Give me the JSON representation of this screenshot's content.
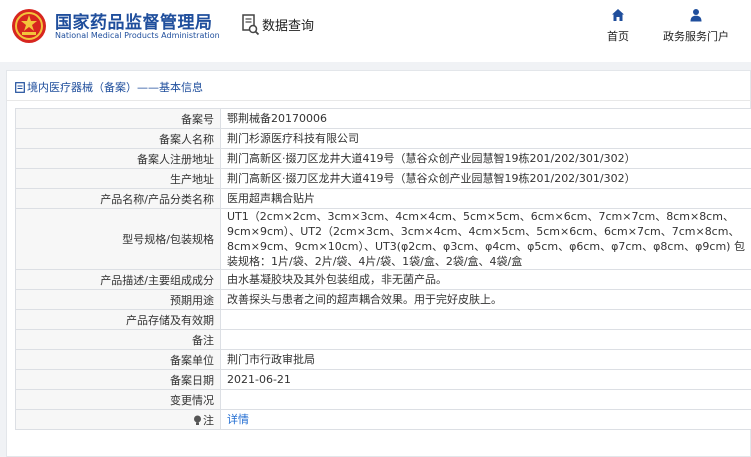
{
  "header": {
    "org_name_cn": "国家药品监督管理局",
    "org_name_en": "National Medical Products Administration",
    "data_query_label": "数据查询",
    "nav": {
      "home_label": "首页",
      "portal_label": "政务服务门户"
    }
  },
  "breadcrumb": {
    "text": "境内医疗器械（备案）——基本信息"
  },
  "colors": {
    "brand_blue": "#1f4e9c",
    "link_blue": "#1f6bd1",
    "label_bg": "#f7f7f7",
    "emblem_red": "#d7261f",
    "emblem_gold": "#f3c33b"
  },
  "record": {
    "rows": [
      {
        "label": "备案号",
        "value": "鄂荆械备20170006"
      },
      {
        "label": "备案人名称",
        "value": "荆门杉源医疗科技有限公司"
      },
      {
        "label": "备案人注册地址",
        "value": "荆门高新区·掇刀区龙井大道419号（慧谷众创产业园慧智19栋201/202/301/302）"
      },
      {
        "label": "生产地址",
        "value": "荆门高新区·掇刀区龙井大道419号（慧谷众创产业园慧智19栋201/202/301/302）"
      },
      {
        "label": "产品名称/产品分类名称",
        "value": "医用超声耦合贴片"
      },
      {
        "label": "型号规格/包装规格",
        "value": "UT1（2cm×2cm、3cm×3cm、4cm×4cm、5cm×5cm、6cm×6cm、7cm×7cm、8cm×8cm、9cm×9cm）、UT2（2cm×3cm、3cm×4cm、4cm×5cm、5cm×6cm、6cm×7cm、7cm×8cm、8cm×9cm、9cm×10cm）、UT3(φ2cm、φ3cm、φ4cm、φ5cm、φ6cm、φ7cm、φ8cm、φ9cm) 包装规格：1片/袋、2片/袋、4片/袋、1袋/盒、2袋/盒、4袋/盒"
      },
      {
        "label": "产品描述/主要组成成分",
        "value": "由水基凝胶块及其外包装组成，非无菌产品。"
      },
      {
        "label": "预期用途",
        "value": "改善探头与患者之间的超声耦合效果。用于完好皮肤上。"
      },
      {
        "label": "产品存储及有效期",
        "value": ""
      },
      {
        "label": "备注",
        "value": ""
      },
      {
        "label": "备案单位",
        "value": "荆门市行政审批局"
      },
      {
        "label": "备案日期",
        "value": "2021-06-21"
      },
      {
        "label": "变更情况",
        "value": ""
      },
      {
        "label": "注",
        "value": "详情",
        "icon": "lightbulb-icon"
      }
    ]
  }
}
